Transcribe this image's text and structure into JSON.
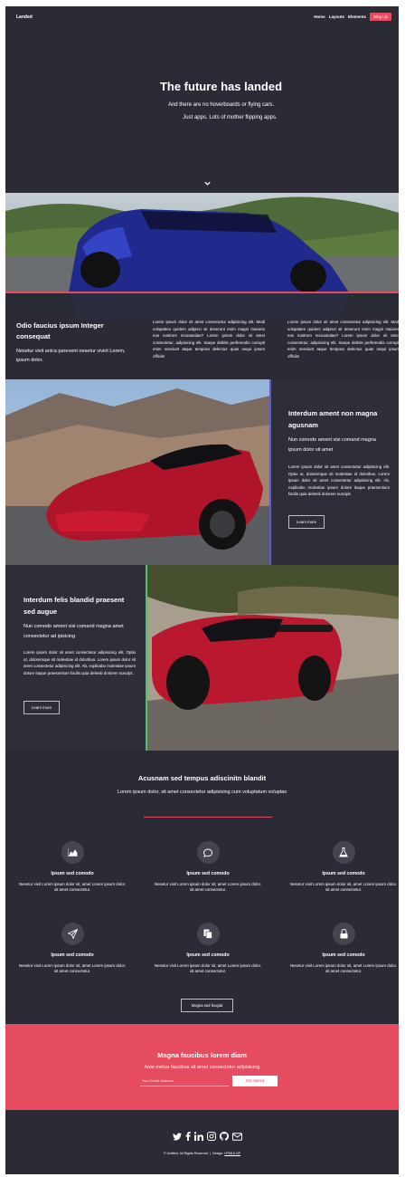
{
  "nav": {
    "brand": "Landed",
    "links": [
      "Home",
      "Layouts",
      "Elements"
    ],
    "cta": "Sing Up"
  },
  "hero": {
    "title": "The future has landed",
    "subtitle_line1": "And there are no hoverboards or flying cars.",
    "subtitle_line2": "Just apps. Lots of mother flipping apps."
  },
  "section_one": {
    "title": "Odio faucius ipsum Integer consequat",
    "text": "Nesetur vivit anica parevent nesetur vivint Lorem, ipsum dolor.",
    "col1": "Lorem ipsum dolor sit amet consectetur adipisicing elit. Modi voluptates quidem adipisci sit deserunt enim magni maiores eos nostrum recusandae? Lorem ipsum dolor sit amet consectetur, adipisicing elit. Saepe debitis perferendis corrupti enim nesciunt atque tempora delectus quas sequi ipsum officiis!",
    "col2": "Lorem ipsum dolor sit amet consectetur adipisicing elit. Modi voluptates quidem adipisci sit deserunt enim magni maiores eos nostrum recusandae? Lorem ipsum dolor sit amet consectetur, adipisicing elit. Saepe debitis perferendis corrupti enim nesciunt atque tempora delectus quas sequi ipsum officiis!"
  },
  "section_two": {
    "title": "Interdum ament non magna agusnam",
    "lead": "Nun comodo ament visi comand magna ipsum dolor sit amet",
    "body": "Lorem ipsum dolor sit amet consectetur adipisicing elit. Optio ut, doloremque sit molestiae id doloribus. Lorem ipsum dolor sit amet consectetur adipisicing elit. Ab, explicabo molestiae ipsum dolore itaque praesentium facilis quia deleniti dolorem suscipit.",
    "button": "Learn more",
    "accent": "#5b5bd6"
  },
  "section_three": {
    "title": "Interdum felis blandid praesent sed augue",
    "lead": "Nun comodo ament visi comand magna amet consectetur ad ipisicing",
    "body": "Lorem ipsum dolor sit amet consectetur adipisicing elit. Optio ut, doloremque sit molestiae id doloribus. Lorem ipsum dolor sit amet consectetur adipisicing elit. Ab, explicabo molestiae ipsum dolore itaque praesentium facilis quia deleniti dolorem suscipit.",
    "button": "Learn more",
    "accent": "#4cc46a"
  },
  "features": {
    "title": "Acusnam sed tempus adiscinitn blandit",
    "subtitle": "Lorem ipsum dolor, sit amet consectetur adipisicing cum voluptatum voluptas",
    "items": [
      {
        "icon": "area-chart-icon",
        "title": "Ipsum sed comodo",
        "text": "Nesetur vivit Lorem ipsum dolor sit, amet Lorem ipsum dolor. sit amet consectetur."
      },
      {
        "icon": "chat-bubble-icon",
        "title": "Ipsum sed comodo",
        "text": "Nesetur vivit Lorem ipsum dolor sit, amet Lorem ipsum dolor. sit amet consectetur."
      },
      {
        "icon": "flask-icon",
        "title": "Ipsum sed comodo",
        "text": "Nesetur vivit Lorem ipsum dolor sit, amet Lorem ipsum dolor. sit amet consectetur."
      },
      {
        "icon": "paper-plane-icon",
        "title": "Ipsum sed comodo",
        "text": "Nesetur vivit Lorem ipsum dolor sit, amet Lorem ipsum dolor. sit amet consectetur."
      },
      {
        "icon": "copy-icon",
        "title": "Ipsum sed comodo",
        "text": "Nesetur vivit Lorem ipsum dolor sit, amet Lorem ipsum dolor. sit amet consectetur."
      },
      {
        "icon": "lock-icon",
        "title": "Ipsum sed comodo",
        "text": "Nesetur vivit Lorem ipsum dolor sit, amet Lorem ipsum dolor. sit amet consectetur."
      }
    ],
    "button": "Magna sed feugiat"
  },
  "cta": {
    "title": "Magna faucibus lorem diam",
    "subtitle": "Ante metus faucibus sit amet consectetur adipisicing",
    "email_placeholder": "Your Email Address",
    "button": "Get started"
  },
  "footer": {
    "social_icons": [
      "twitter-icon",
      "facebook-icon",
      "linkedin-icon",
      "instagram-icon",
      "github-icon",
      "email-icon"
    ],
    "copyright": "© Untitled. All Rights Reserved",
    "design_label": "Design:",
    "design_link": "HTML5 UP"
  },
  "colors": {
    "background": "#2b2b35",
    "accent": "#e54c5f",
    "icon_circle": "#45454f"
  }
}
